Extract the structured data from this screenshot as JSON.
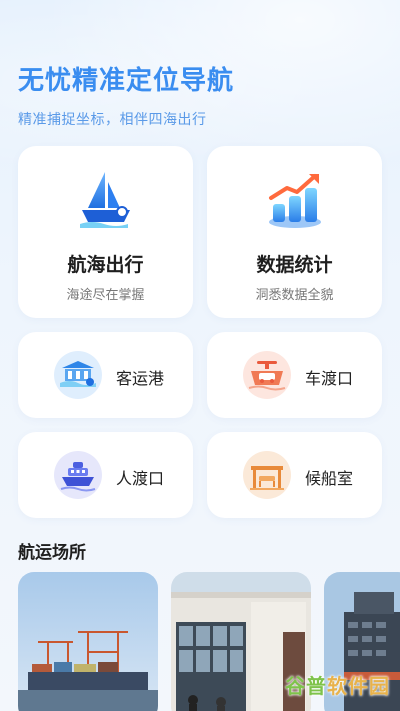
{
  "hero": {
    "title": "无忧精准定位导航",
    "subtitle": "精准捕捉坐标，相伴四海出行"
  },
  "cards": {
    "navigation": {
      "title": "航海出行",
      "subtitle": "海途尽在掌握",
      "icon": "sailboat-icon"
    },
    "statistics": {
      "title": "数据统计",
      "subtitle": "洞悉数据全貌",
      "icon": "bar-chart-icon"
    }
  },
  "quick": [
    {
      "label": "客运港",
      "icon": "passenger-port-icon"
    },
    {
      "label": "车渡口",
      "icon": "car-ferry-icon"
    },
    {
      "label": "人渡口",
      "icon": "ferry-icon"
    },
    {
      "label": "候船室",
      "icon": "waiting-room-icon"
    }
  ],
  "section": {
    "title": "航运场所"
  },
  "watermark": {
    "part1": "谷普",
    "part2": "软件园"
  },
  "colors": {
    "accent": "#3a8df0",
    "blue_icon_bg": "#dfeefd",
    "orange_icon_bg": "#fde6df",
    "purple_icon_bg": "#e6e7fb",
    "amber_icon_bg": "#fbe9d8"
  }
}
